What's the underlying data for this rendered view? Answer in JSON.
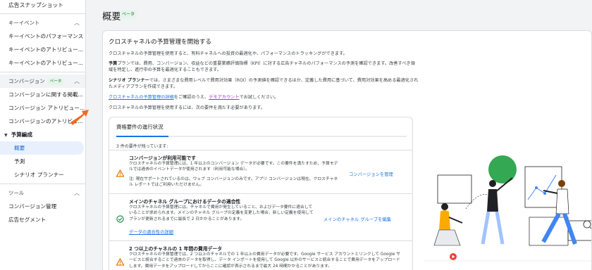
{
  "sidebar": {
    "top_item": "広告スナップショット",
    "sections": {
      "key_events": {
        "label": "キーイベント",
        "items": [
          "キーイベントのパフォーマンス",
          "キーイベントのアトリビュー...",
          "キーイベントのアトリビュー..."
        ]
      },
      "conversions": {
        "label": "コンバージョン",
        "badge": "ベータ",
        "items": [
          "コンバージョンに関する掲載...",
          "コンバージョン アトリビュー...",
          "コンバージョンのアトリビュ..."
        ]
      },
      "budgeting": {
        "label": "予算編成",
        "items": [
          "概要",
          "予測",
          "シナリオ プランナー"
        ]
      },
      "tools": {
        "label": "ツール",
        "items": [
          "コンバージョン管理",
          "広告セグメント"
        ]
      }
    }
  },
  "main": {
    "title": "概要",
    "badge": "ベータ",
    "card": {
      "title": "クロスチャネルの予算管理を開始する",
      "intro": "クロスチャネルの予算管理を使用すると、有料チャネルへの投資の最適化や、パフォーマンスのトラッキングができます。",
      "plan_term": "予算",
      "plan_text": "プランでは、費用、コンバージョン、収益などの重要業績評価指標（KPI）に対する広告チャネルのパフォーマンスの予測を確認できます。改善すべき領域を特定し、進行中の予算を最適化することもできます。",
      "scenario_term": "シナリオ プランナー",
      "scenario_text": "では、さまざまな費用レベルで費用対効果（ROI）の予測値を確認できるほか、定義した費用に基づいて、費用対効果を高める最適化されたメディアプランを作成できます。",
      "details_link": "クロスチャネルの予算管理の詳細",
      "mid_text": "をご確認のうえ、",
      "demo_link": "デモアカウント",
      "end_text": "でお試しください。",
      "requirement_line": "クロスチャネルの予算管理を使用するには、次の要件を満たす必要があります。"
    },
    "requirements": {
      "title": "資格要件の進行状況",
      "progress_fraction": 0.18,
      "remaining": "3 件の要件が残っています:",
      "items": [
        {
          "title": "コンバージョンが利用可能です",
          "body1": "クロスチャネルの予算管理には、1 年以上のコンバージョン データが必要です。この要件を満たすため、予算モデルでは過去のイベントデータが使用されます（利用可能な場合）。",
          "body2": "注: 現在サポートされているのは、ウェブ コンバージョンのみです。アプリ コンバージョンは現在、クロスチャネル レポートではご利用いただけません。",
          "action": "コンバージョンを管理",
          "status": "warning"
        },
        {
          "title": "メインのチャネル グループにおけるデータの適合性",
          "body1": "クロスチャネルの予算管理には、チャネルで費用が発生していること、およびデータ要件に適合していることが求められます。メインのチャネル グループの定義を変更した場合、新しい定義を使用してプランが更新されるまでに最長で 2 日かかることがあります。",
          "link": "データの適合性の詳細",
          "action": "メインのチャネル グループを編集",
          "status": "ok"
        },
        {
          "title": "2 つ以上のチャネルの 1 年間の費用データ",
          "body1": "クロスチャネルの予算管理では、2 つ以上のチャネルでの 1 年以上の費用データが必要です。Google サービス アカウントとリンクして Google サービスと統合することで過去のデータを取得し、データ インポートを使用して Google 以外のサービスと統合することで費用データをアップロードします。費用データをアップロードしてからここに確認が表示されるまで最大 24 時間かかることがあります。",
          "status": "warning"
        }
      ]
    },
    "colors": {
      "accent": "#1a73e8",
      "warning": "#e37400",
      "ok": "#188038",
      "pointer": "#f26b21"
    }
  }
}
